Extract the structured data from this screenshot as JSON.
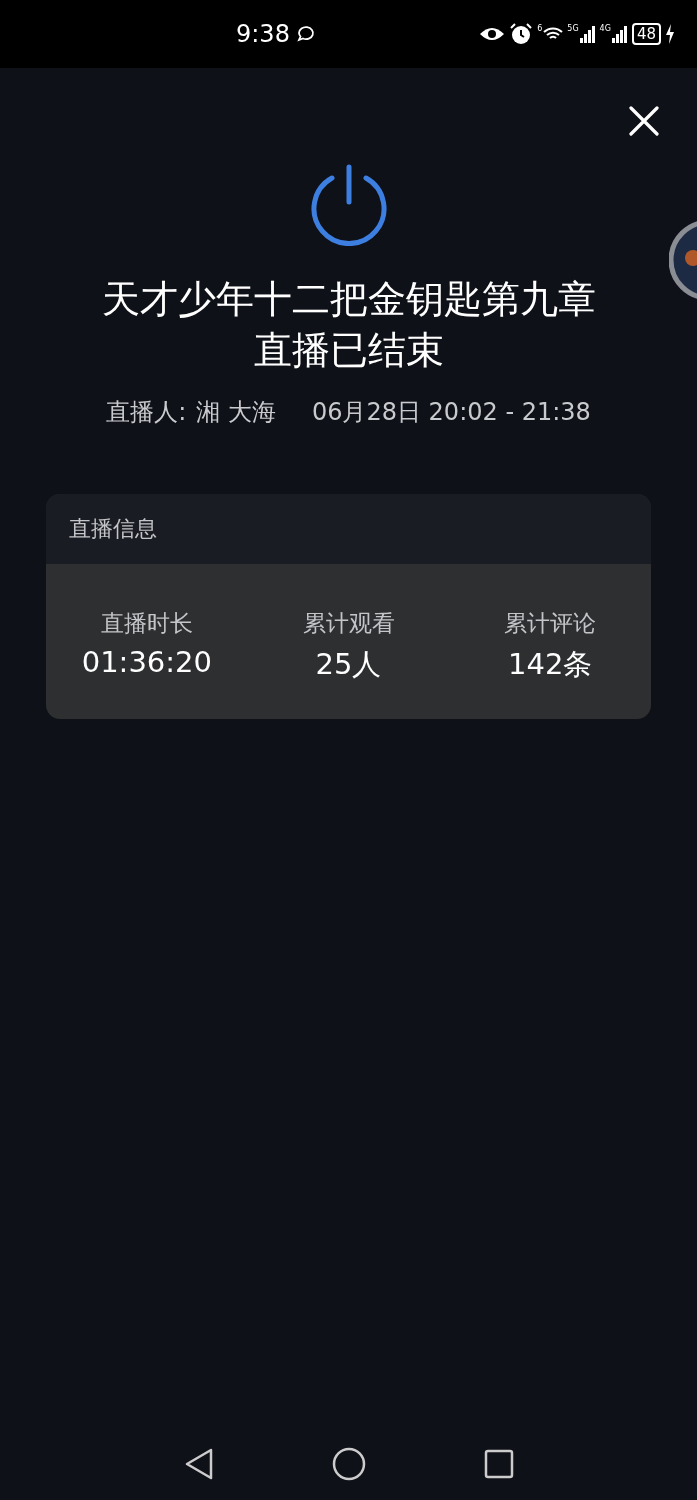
{
  "status_bar": {
    "time": "9:38",
    "wifi_badge": "6",
    "sim_1": "5G",
    "sim_2": "4G",
    "battery": "48"
  },
  "title": "天才少年十二把金钥匙第九章",
  "subtitle": "直播已结束",
  "host_label": "直播人:",
  "host_name": "湘 大海",
  "time_range": "06月28日 20:02 - 21:38",
  "info_card": {
    "title": "直播信息",
    "stats": [
      {
        "label": "直播时长",
        "value": "01:36:20"
      },
      {
        "label": "累计观看",
        "value": "25人"
      },
      {
        "label": "累计评论",
        "value": "142条"
      }
    ]
  }
}
